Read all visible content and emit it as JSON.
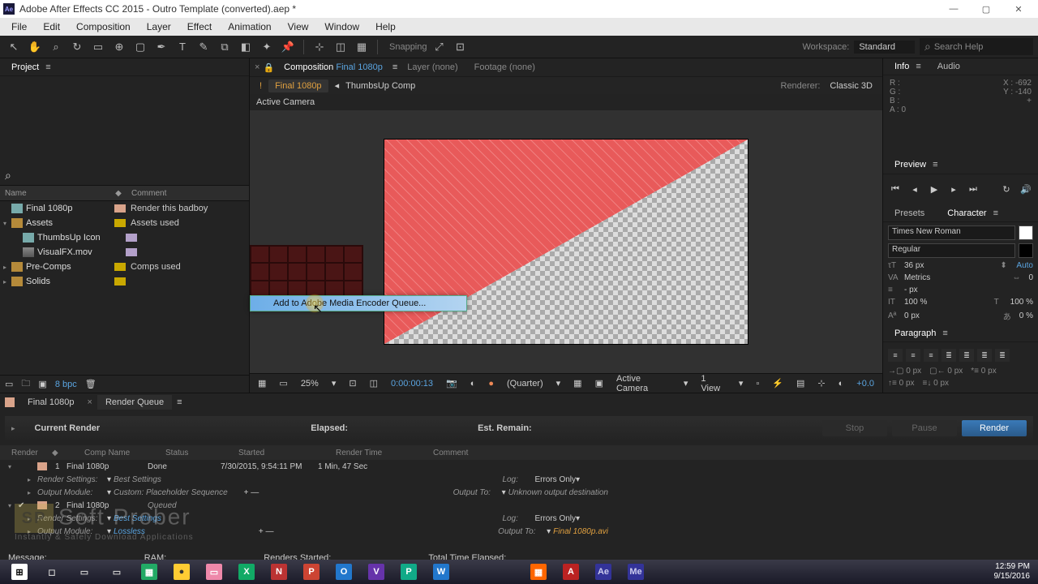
{
  "titlebar": {
    "icon": "Ae",
    "title": "Adobe After Effects CC 2015 - Outro Template (converted).aep *"
  },
  "menus": [
    "File",
    "Edit",
    "Composition",
    "Layer",
    "Effect",
    "Animation",
    "View",
    "Window",
    "Help"
  ],
  "toolbar": {
    "snap": "Snapping",
    "wslabel": "Workspace:",
    "ws": "Standard",
    "search": "Search Help"
  },
  "project": {
    "title": "Project",
    "cols": {
      "name": "Name",
      "comment": "Comment"
    },
    "items": [
      {
        "indent": 0,
        "twisty": "",
        "icon": "comp",
        "name": "Final 1080p",
        "tag": "tag-peach",
        "comment": "Render this badboy"
      },
      {
        "indent": 0,
        "twisty": "▾",
        "icon": "folder",
        "name": "Assets",
        "tag": "tag-yellow",
        "comment": "Assets used"
      },
      {
        "indent": 1,
        "twisty": "",
        "icon": "comp",
        "name": "ThumbsUp Icon",
        "tag": "tag-lav",
        "comment": ""
      },
      {
        "indent": 1,
        "twisty": "",
        "icon": "mov",
        "name": "VisualFX.mov",
        "tag": "tag-lav",
        "comment": ""
      },
      {
        "indent": 0,
        "twisty": "▸",
        "icon": "folder",
        "name": "Pre-Comps",
        "tag": "tag-yellow",
        "comment": "Comps used"
      },
      {
        "indent": 0,
        "twisty": "▸",
        "icon": "folder",
        "name": "Solids",
        "tag": "tag-yellow",
        "comment": ""
      }
    ],
    "bpc": "8 bpc"
  },
  "comp": {
    "tabs": {
      "comp": "Composition",
      "compname": "Final 1080p",
      "layer": "Layer (none)",
      "footage": "Footage (none)"
    },
    "bread1": "Final 1080p",
    "bread2": "ThumbsUp Comp",
    "rendererlbl": "Renderer:",
    "renderer": "Classic 3D",
    "camera": "Active Camera",
    "ctxmenu": "Add to Adobe Media Encoder Queue...",
    "footer": {
      "zoom": "25%",
      "tc": "0:00:00:13",
      "res": "(Quarter)",
      "cam": "Active Camera",
      "views": "1 View",
      "exp": "+0.0"
    }
  },
  "info": {
    "tab1": "Info",
    "tab2": "Audio",
    "r": "R :",
    "g": "G :",
    "b": "B :",
    "a": "A : 0",
    "x": "X : -692",
    "y": "Y : -140"
  },
  "preview": {
    "title": "Preview"
  },
  "panels": {
    "presets": "Presets",
    "character": "Character"
  },
  "char": {
    "font": "Times New Roman",
    "style": "Regular",
    "size": "36 px",
    "lead": "Auto",
    "kern": "Metrics",
    "track": "0",
    "dash": "- px",
    "vs": "100 %",
    "hs": "100 %",
    "base": "0 px",
    "tsume": "0 %"
  },
  "para": {
    "title": "Paragraph",
    "z": "0 px"
  },
  "bottom": {
    "tabs": {
      "comp": "Final 1080p",
      "rq": "Render Queue"
    },
    "current": "Current Render",
    "elapsed": "Elapsed:",
    "remain": "Est. Remain:",
    "btns": {
      "stop": "Stop",
      "pause": "Pause",
      "render": "Render"
    },
    "cols": {
      "render": "Render",
      "comp": "Comp Name",
      "status": "Status",
      "started": "Started",
      "rtime": "Render Time",
      "comment": "Comment"
    },
    "job1": {
      "num": "1",
      "name": "Final 1080p",
      "status": "Done",
      "started": "7/30/2015, 9:54:11 PM",
      "rtime": "1 Min, 47 Sec",
      "rslabel": "Render Settings:",
      "rs": "Best Settings",
      "omlabel": "Output Module:",
      "om": "Custom: Placeholder Sequence",
      "loglabel": "Log:",
      "log": "Errors Only",
      "otlabel": "Output To:",
      "ot": "Unknown output destination"
    },
    "job2": {
      "num": "2",
      "name": "Final 1080p",
      "status": "Queued",
      "rslabel": "Render Settings:",
      "rs": "Best Settings",
      "omlabel": "Output Module:",
      "om": "Lossless",
      "loglabel": "Log:",
      "log": "Errors Only",
      "otlabel": "Output To:",
      "ot": "Final 1080p.avi"
    },
    "status": {
      "msg": "Message:",
      "ram": "RAM:",
      "rs": "Renders Started:",
      "tt": "Total Time Elapsed:"
    }
  },
  "watermark": {
    "sp": "SP",
    "name": "Soft Prober",
    "sub": "Instantly & Safely Download Applications"
  },
  "taskbar": {
    "apps": [
      {
        "bg": "#fff",
        "c": "#000",
        "t": "⊞"
      },
      {
        "bg": "transparent",
        "c": "#ccc",
        "t": "◻"
      },
      {
        "bg": "transparent",
        "c": "#ccc",
        "t": "▭"
      },
      {
        "bg": "transparent",
        "c": "#ccc",
        "t": "▭"
      },
      {
        "bg": "#2a6",
        "c": "#fff",
        "t": "▦"
      },
      {
        "bg": "#fc3",
        "c": "#333",
        "t": "●"
      },
      {
        "bg": "#e8a",
        "c": "#fff",
        "t": "▭"
      },
      {
        "bg": "#1a6",
        "c": "#fff",
        "t": "X"
      },
      {
        "bg": "#b33",
        "c": "#fff",
        "t": "N"
      },
      {
        "bg": "#c43",
        "c": "#fff",
        "t": "P"
      },
      {
        "bg": "#27c",
        "c": "#fff",
        "t": "O"
      },
      {
        "bg": "#63a",
        "c": "#fff",
        "t": "V"
      },
      {
        "bg": "#1a8",
        "c": "#fff",
        "t": "P"
      },
      {
        "bg": "#27c",
        "c": "#fff",
        "t": "W"
      },
      {
        "bg": "transparent",
        "c": "#ccc",
        "t": ""
      },
      {
        "bg": "transparent",
        "c": "#ccc",
        "t": ""
      },
      {
        "bg": "#f60",
        "c": "#fff",
        "t": "▦"
      },
      {
        "bg": "#b22",
        "c": "#fff",
        "t": "A"
      },
      {
        "bg": "#339",
        "c": "#cce",
        "t": "Ae"
      },
      {
        "bg": "#339",
        "c": "#cce",
        "t": "Me"
      }
    ],
    "time": "12:59 PM",
    "date": "9/15/2016"
  }
}
